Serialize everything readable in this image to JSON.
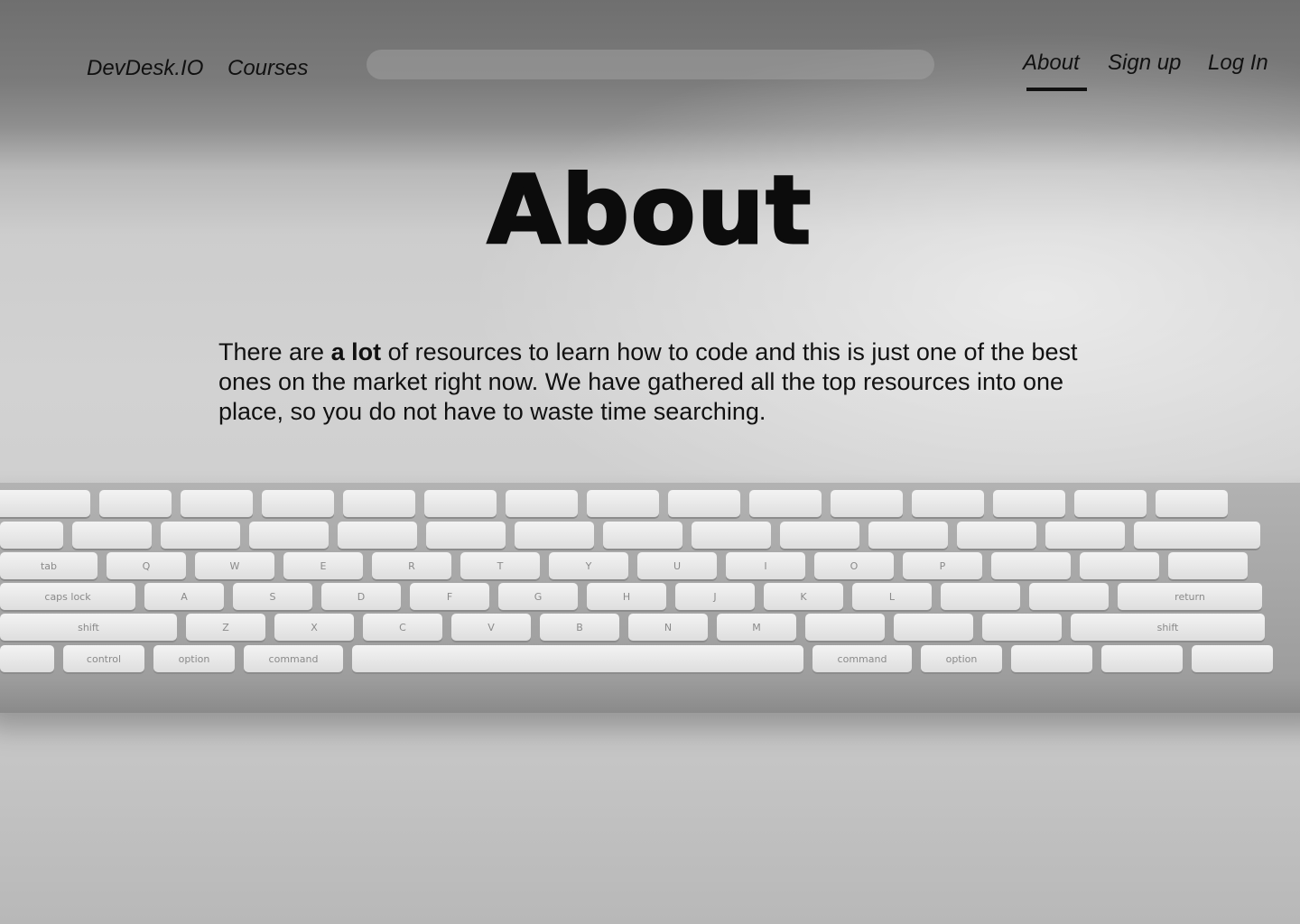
{
  "header": {
    "brand": "DevDesk.IO",
    "nav_left": {
      "courses": "Courses"
    },
    "search": {
      "value": "",
      "placeholder": ""
    },
    "nav_right": {
      "about": "About",
      "signup": "Sign up",
      "login": "Log In"
    },
    "active_tab": "About"
  },
  "main": {
    "title": "About",
    "paragraph": {
      "before": "There are ",
      "emphasis": "a lot",
      "after": " of resources to learn how to code and this is just one of the best ones on the market right now. We have gathered all the top resources into one place, so you do not have to waste time searching."
    }
  },
  "keyboard_labels": {
    "row_top": [
      "Q",
      "W",
      "E",
      "R",
      "T",
      "Y",
      "U",
      "I",
      "O",
      "P"
    ],
    "row_home": [
      "A",
      "S",
      "D",
      "F",
      "G",
      "H",
      "J",
      "K",
      "L"
    ],
    "row_bottom": [
      "Z",
      "X",
      "C",
      "V",
      "B",
      "N",
      "M"
    ],
    "mods": [
      "tab",
      "caps lock",
      "shift",
      "control",
      "option",
      "command",
      "return"
    ]
  },
  "colors": {
    "text": "#111111",
    "search_bg": "#9a9a9a",
    "active_underline": "#111111"
  }
}
